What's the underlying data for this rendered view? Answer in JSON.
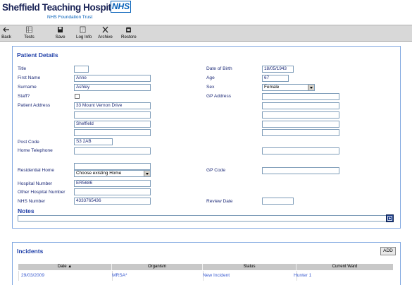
{
  "header": {
    "title": "Sheffield Teaching Hospitals",
    "logo_text": "NHS",
    "subtitle": "NHS Foundation Trust"
  },
  "toolbar": {
    "back": "Back",
    "tests": "Tests",
    "save": "Save",
    "log_info": "Log Info",
    "archive": "Archive",
    "restore": "Restore"
  },
  "patient_details": {
    "heading": "Patient Details",
    "labels": {
      "title": "Title",
      "first_name": "First Name",
      "surname": "Surname",
      "staff": "Staff?",
      "patient_address": "Patient Address",
      "post_code": "Post Code",
      "home_telephone": "Home Telephone",
      "residential_home": "Residential Home",
      "hospital_number": "Hospital Number",
      "other_hospital_number": "Other Hospital Number",
      "nhs_number": "NHS Number",
      "date_of_birth": "Date of Birth",
      "age": "Age",
      "sex": "Sex",
      "gp_address": "GP Address",
      "gp_code": "GP Code",
      "review_date": "Review Date"
    },
    "values": {
      "title": "",
      "first_name": "Anne",
      "surname": "Ashley",
      "staff_checked": false,
      "address_line1": "33 Mount Vernon Drive",
      "address_line2": "",
      "address_line3": "Sheffield",
      "address_line4": "",
      "post_code": "S3 2AB",
      "home_telephone": "",
      "residential_home_text": "",
      "residential_home_select": "Choose existing Home",
      "hospital_number": "ER5686",
      "other_hospital_number": "",
      "nhs_number": "4333765436",
      "date_of_birth": "18/05/1943",
      "age": "67",
      "sex": "Female",
      "gp_address_1": "",
      "gp_address_2": "",
      "gp_address_3": "",
      "gp_address_4": "",
      "gp_address_5": "",
      "gp_address_6": "",
      "gp_code": "",
      "review_date": ""
    }
  },
  "notes": {
    "heading": "Notes",
    "value": ""
  },
  "incidents": {
    "heading": "Incidents",
    "add_label": "ADD",
    "columns": [
      "Date ▲",
      "Organism",
      "Status",
      "Current Ward"
    ],
    "rows": [
      [
        "29/03/2009",
        "MRSA*",
        "New Incident",
        "Hunter 1"
      ]
    ]
  }
}
